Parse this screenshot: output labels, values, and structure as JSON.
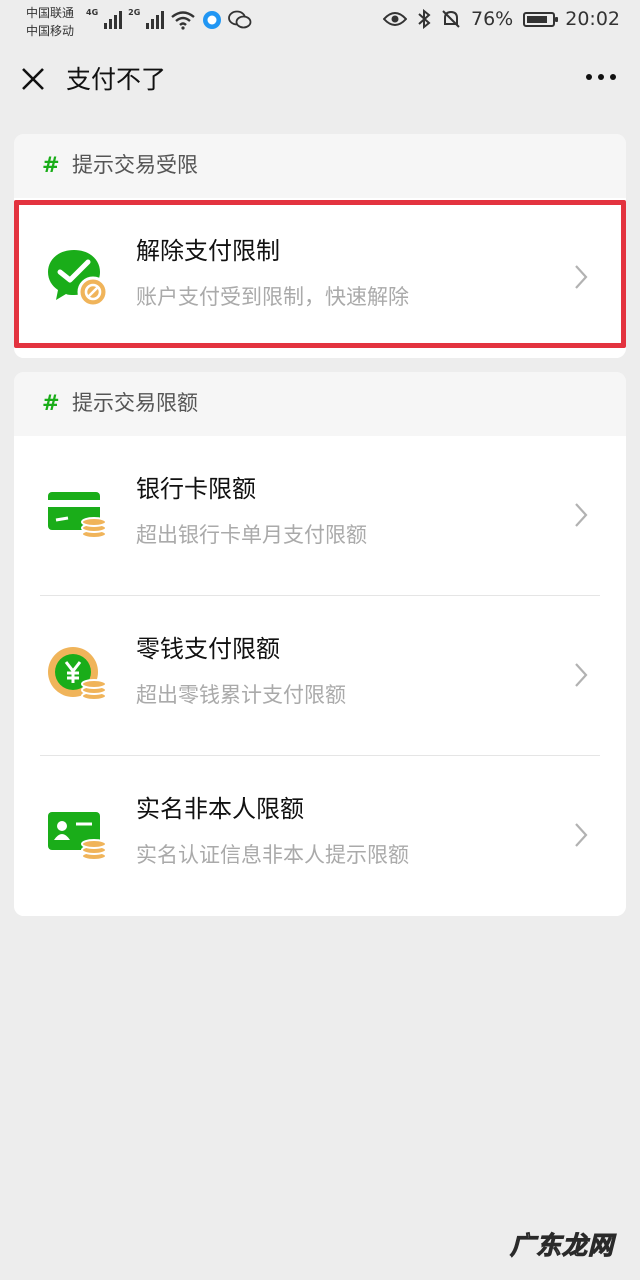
{
  "status_bar": {
    "carrier1": "中国联通",
    "carrier2": "中国移动",
    "net1": "4G",
    "net2": "2G",
    "battery": "76%",
    "time": "20:02"
  },
  "header": {
    "title": "支付不了"
  },
  "sections": [
    {
      "title": "提示交易受限",
      "hash": "#",
      "items": [
        {
          "title": "解除支付限制",
          "desc": "账户支付受到限制，快速解除",
          "icon": "wechat-pay-blocked-icon"
        }
      ]
    },
    {
      "title": "提示交易限额",
      "hash": "#",
      "items": [
        {
          "title": "银行卡限额",
          "desc": "超出银行卡单月支付限额",
          "icon": "bank-card-icon"
        },
        {
          "title": "零钱支付限额",
          "desc": "超出零钱累计支付限额",
          "icon": "balance-coin-icon"
        },
        {
          "title": "实名非本人限额",
          "desc": "实名认证信息非本人提示限额",
          "icon": "id-card-icon"
        }
      ]
    }
  ],
  "colors": {
    "accent": "#1aad19",
    "highlight": "#e3333f",
    "coin": "#f0b45a"
  },
  "watermark": "广东龙网"
}
